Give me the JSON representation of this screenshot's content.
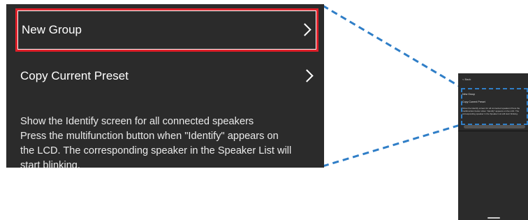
{
  "zoom": {
    "items": [
      {
        "label": "New Group",
        "selected": true
      },
      {
        "label": "Copy Current Preset",
        "selected": false
      }
    ],
    "description": [
      "Show the Identify screen for all connected speakers",
      "Press the multifunction button when \"Identify\" appears on",
      "the LCD. The corresponding speaker in the Speaker List will",
      "start blinking."
    ]
  },
  "phone": {
    "back": "< Back",
    "items": [
      "New Group",
      "Copy Current Preset"
    ],
    "description": "Show the Identify screen for all connected speakers Press the multifunction button when \"Identify\" appears on the LCD. The corresponding speaker in the Speaker List will start blinking."
  },
  "colors": {
    "highlight": "#e0202a",
    "callout": "#2f7ec7",
    "panel": "#2b2b2b"
  }
}
